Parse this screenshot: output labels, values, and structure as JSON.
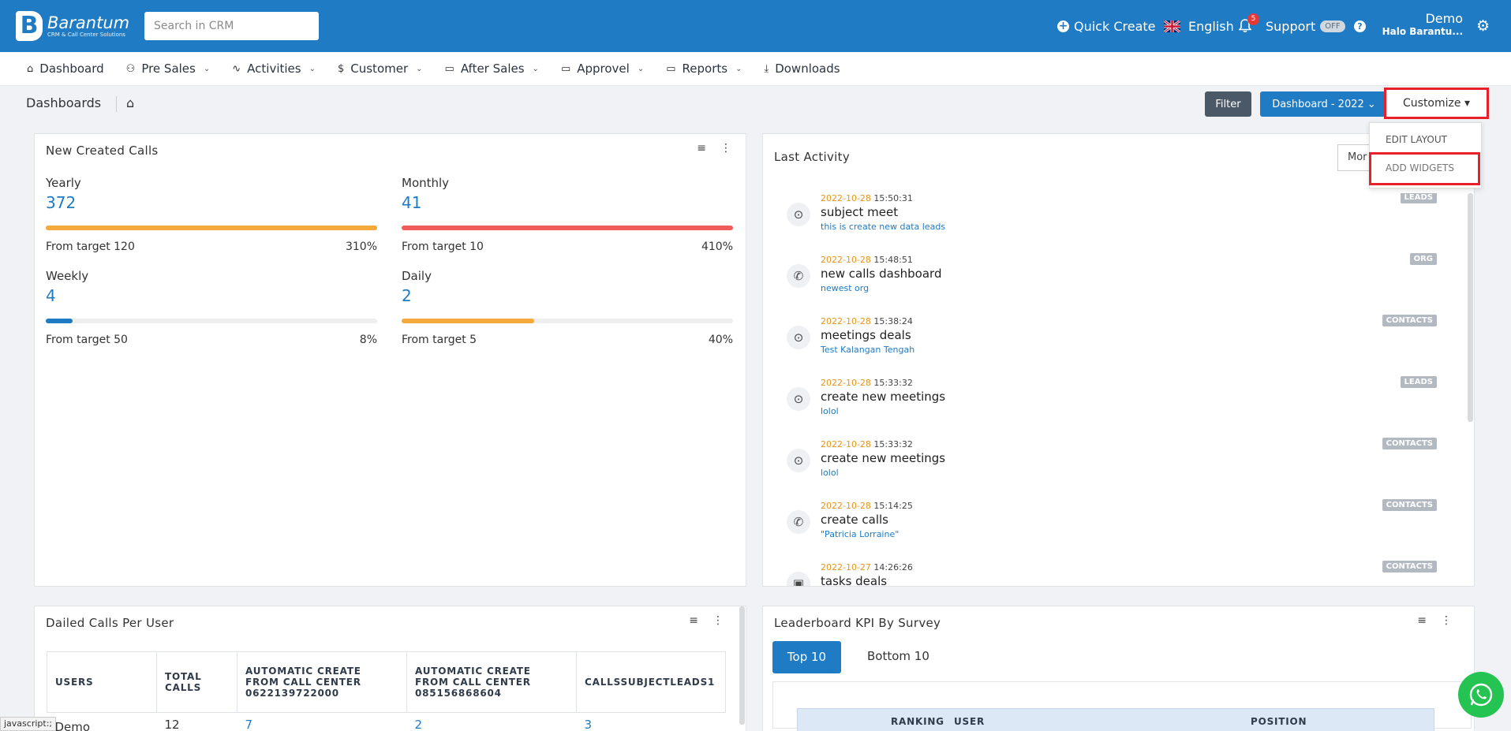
{
  "brand": {
    "name": "Barantum",
    "tagline": "CRM & Call Center Solutions",
    "color": "#1e7bc4"
  },
  "search": {
    "placeholder": "Search in CRM"
  },
  "topbar": {
    "quick_create": "Quick Create",
    "language": "English",
    "notification_count": "5",
    "support": "Support",
    "support_state": "OFF",
    "user_name": "Demo",
    "user_sub": "Halo Barantu..."
  },
  "nav": [
    {
      "label": "Dashboard",
      "icon": "home-icon",
      "chevron": false
    },
    {
      "label": "Pre Sales",
      "icon": "users-icon",
      "chevron": true
    },
    {
      "label": "Activities",
      "icon": "activity-icon",
      "chevron": true
    },
    {
      "label": "Customer",
      "icon": "dollar-icon",
      "chevron": true
    },
    {
      "label": "After Sales",
      "icon": "folder-icon",
      "chevron": true
    },
    {
      "label": "Approvel",
      "icon": "folder-icon",
      "chevron": true
    },
    {
      "label": "Reports",
      "icon": "folder-icon",
      "chevron": true
    },
    {
      "label": "Downloads",
      "icon": "download-icon",
      "chevron": false
    }
  ],
  "page": {
    "title": "Dashboards",
    "filter": "Filter",
    "dashboard_select": "Dashboard - 2022",
    "customize": "Customize",
    "menu": {
      "edit_layout": "EDIT LAYOUT",
      "add_widgets": "ADD WIDGETS"
    }
  },
  "new_calls": {
    "title": "New Created Calls",
    "stats": [
      {
        "label": "Yearly",
        "value": "372",
        "target": "From target 120",
        "percent": "310%",
        "fill": 1.0,
        "color": "#f5a93a"
      },
      {
        "label": "Monthly",
        "value": "41",
        "target": "From target 10",
        "percent": "410%",
        "fill": 1.0,
        "color": "#f05b5b"
      },
      {
        "label": "Weekly",
        "value": "4",
        "target": "From target 50",
        "percent": "8%",
        "fill": 0.08,
        "color": "#1e7bc4"
      },
      {
        "label": "Daily",
        "value": "2",
        "target": "From target 5",
        "percent": "40%",
        "fill": 0.4,
        "color": "#f5a93a"
      }
    ]
  },
  "last_activity": {
    "title": "Last Activity",
    "period": "Mor",
    "items": [
      {
        "date": "2022-10-28",
        "time": " 15:50:31",
        "subject": "subject meet",
        "sub": "this is create new data leads",
        "tag": "LEADS",
        "icon": "location-icon"
      },
      {
        "date": "2022-10-28",
        "time": " 15:48:51",
        "subject": "new calls dashboard",
        "sub": "newest org",
        "tag": "ORG",
        "icon": "phone-icon"
      },
      {
        "date": "2022-10-28",
        "time": " 15:38:24",
        "subject": "meetings deals",
        "sub": "Test Kalangan Tengah",
        "tag": "CONTACTS",
        "icon": "location-icon"
      },
      {
        "date": "2022-10-28",
        "time": " 15:33:32",
        "subject": "create new meetings",
        "sub": "lolol",
        "tag": "LEADS",
        "icon": "location-icon"
      },
      {
        "date": "2022-10-28",
        "time": " 15:33:32",
        "subject": "create new meetings",
        "sub": "lolol",
        "tag": "CONTACTS",
        "icon": "location-icon"
      },
      {
        "date": "2022-10-28",
        "time": " 15:14:25",
        "subject": "create calls",
        "sub": "\"Patricia Lorraine\"",
        "tag": "CONTACTS",
        "icon": "phone-icon"
      },
      {
        "date": "2022-10-27",
        "time": " 14:26:26",
        "subject": "tasks deals",
        "sub": "",
        "tag": "CONTACTS",
        "icon": "briefcase-icon"
      }
    ]
  },
  "dialed_calls": {
    "title": "Dailed Calls Per User",
    "headers": [
      "USERS",
      "TOTAL CALLS",
      "AUTOMATIC CREATE FROM CALL CENTER 0622139722000",
      "AUTOMATIC CREATE FROM CALL CENTER 085156868604",
      "CALLSSUBJECTLEADS1"
    ],
    "rows": [
      {
        "user": "Demo",
        "total": "12",
        "a": "7",
        "b": "2",
        "c": "3"
      }
    ]
  },
  "leaderboard": {
    "title": "Leaderboard KPI By Survey",
    "tab_top": "Top 10",
    "tab_bottom": "Bottom 10",
    "headers": [
      "RANKING",
      "USER",
      "POSITION"
    ]
  },
  "status_bar": "javascript:;"
}
